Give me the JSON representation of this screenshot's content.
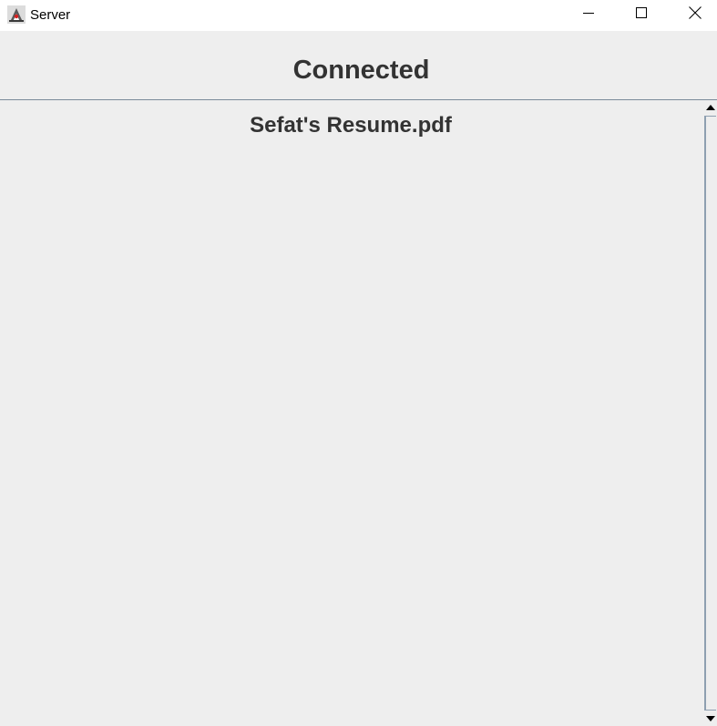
{
  "window": {
    "title": "Server",
    "app_icon": "java-duke-icon",
    "controls": {
      "minimize_icon": "minimize-icon",
      "maximize_icon": "maximize-icon",
      "close_icon": "close-icon"
    }
  },
  "header": {
    "status_text": "Connected"
  },
  "files": {
    "items": [
      {
        "name": "Sefat's Resume.pdf"
      }
    ]
  },
  "scrollbar": {
    "up_icon": "scroll-up-arrow-icon",
    "down_icon": "scroll-down-arrow-icon"
  }
}
